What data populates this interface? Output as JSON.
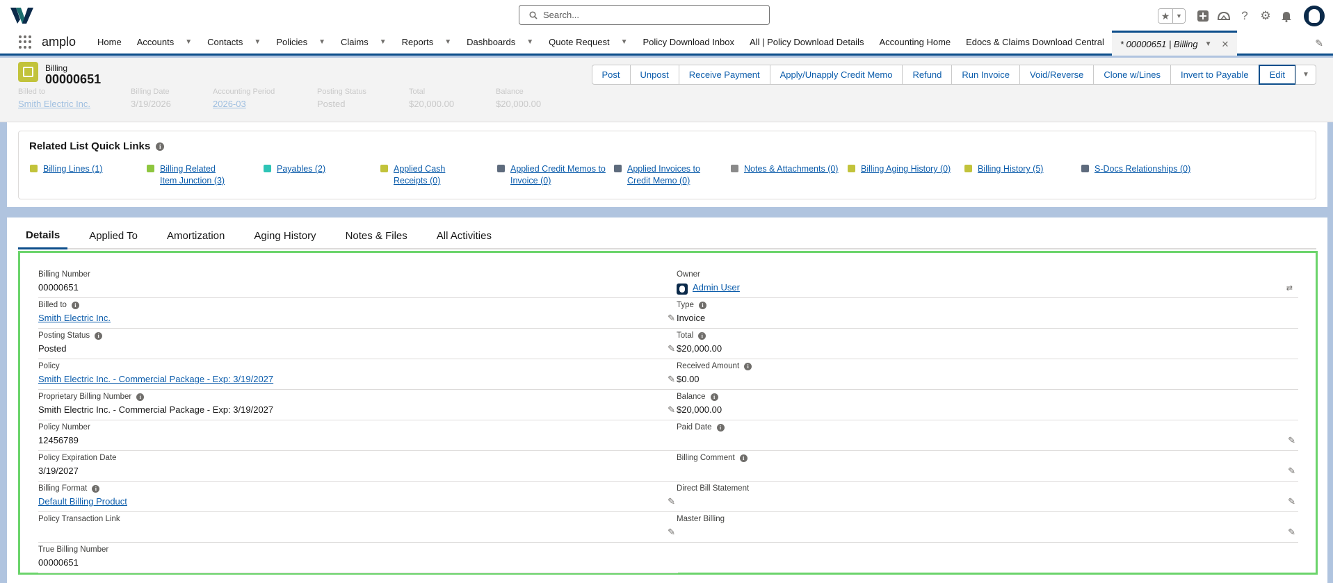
{
  "search": {
    "placeholder": "Search..."
  },
  "nav": {
    "app_name": "amplo",
    "items": [
      {
        "label": "Home",
        "has_menu": false
      },
      {
        "label": "Accounts",
        "has_menu": true
      },
      {
        "label": "Contacts",
        "has_menu": true
      },
      {
        "label": "Policies",
        "has_menu": true
      },
      {
        "label": "Claims",
        "has_menu": true
      },
      {
        "label": "Reports",
        "has_menu": true
      },
      {
        "label": "Dashboards",
        "has_menu": true
      },
      {
        "label": "Quote Request",
        "has_menu": true
      },
      {
        "label": "Policy Download Inbox",
        "has_menu": false
      },
      {
        "label": "All | Policy Download Details",
        "has_menu": false
      },
      {
        "label": "Accounting Home",
        "has_menu": false
      },
      {
        "label": "Edocs & Claims Download Central",
        "has_menu": false
      }
    ],
    "active_tab": "* 00000651 | Billing"
  },
  "record": {
    "object_label": "Billing",
    "name": "00000651",
    "actions": [
      "Post",
      "Unpost",
      "Receive Payment",
      "Apply/Unapply Credit Memo",
      "Refund",
      "Run Invoice",
      "Void/Reverse",
      "Clone w/Lines",
      "Invert to Payable",
      "Edit"
    ],
    "highlights": [
      {
        "label": "Billed to",
        "value": "Smith Electric Inc.",
        "link": true
      },
      {
        "label": "Billing Date",
        "value": "3/19/2026",
        "link": false
      },
      {
        "label": "Accounting Period",
        "value": "2026-03",
        "link": true
      },
      {
        "label": "Posting Status",
        "value": "Posted",
        "link": false
      },
      {
        "label": "Total",
        "value": "$20,000.00",
        "link": false
      },
      {
        "label": "Balance",
        "value": "$20,000.00",
        "link": false
      }
    ]
  },
  "quick_links": {
    "title": "Related List Quick Links",
    "items": [
      {
        "label": "Billing Lines (1)",
        "color": "#c2c33b"
      },
      {
        "label": "Billing Related Item Junction (3)",
        "color": "#8ec63f"
      },
      {
        "label": "Payables (2)",
        "color": "#2ec4b6"
      },
      {
        "label": "Applied Cash Receipts (0)",
        "color": "#c2c33b"
      },
      {
        "label": "Applied Credit Memos to Invoice (0)",
        "color": "#5e6b7d"
      },
      {
        "label": "Applied Invoices to Credit Memo (0)",
        "color": "#5e6b7d"
      },
      {
        "label": "Notes & Attachments (0)",
        "color": "#8a8a8a"
      },
      {
        "label": "Billing Aging History (0)",
        "color": "#c2c33b"
      },
      {
        "label": "Billing History (5)",
        "color": "#c2c33b"
      },
      {
        "label": "S-Docs Relationships (0)",
        "color": "#5e6b7d"
      }
    ]
  },
  "tabs": [
    "Details",
    "Applied To",
    "Amortization",
    "Aging History",
    "Notes & Files",
    "All Activities"
  ],
  "details": {
    "left": [
      {
        "label": "Billing Number",
        "value": "00000651",
        "link": false,
        "info": false,
        "editable": false
      },
      {
        "label": "Billed to",
        "value": "Smith Electric Inc.",
        "link": true,
        "info": true,
        "editable": true
      },
      {
        "label": "Posting Status",
        "value": "Posted",
        "link": false,
        "info": true,
        "editable": true
      },
      {
        "label": "Policy",
        "value": "Smith Electric Inc. - Commercial Package - Exp: 3/19/2027",
        "link": true,
        "info": false,
        "editable": true
      },
      {
        "label": "Proprietary Billing Number",
        "value": "Smith Electric Inc. - Commercial Package - Exp: 3/19/2027",
        "link": false,
        "info": true,
        "editable": true
      },
      {
        "label": "Policy Number",
        "value": "12456789",
        "link": false,
        "info": false,
        "editable": false
      },
      {
        "label": "Policy Expiration Date",
        "value": "3/19/2027",
        "link": false,
        "info": false,
        "editable": false
      },
      {
        "label": "Billing Format",
        "value": "Default Billing Product",
        "link": true,
        "info": true,
        "editable": true
      },
      {
        "label": "Policy Transaction Link",
        "value": "",
        "link": false,
        "info": false,
        "editable": true
      },
      {
        "label": "True Billing Number",
        "value": "00000651",
        "link": false,
        "info": false,
        "editable": false
      }
    ],
    "right": [
      {
        "label": "Owner",
        "value": "Admin User",
        "link": true,
        "info": false,
        "editable": false
      },
      {
        "label": "Type",
        "value": "Invoice",
        "link": false,
        "info": true,
        "editable": false
      },
      {
        "label": "Total",
        "value": "$20,000.00",
        "link": false,
        "info": true,
        "editable": false
      },
      {
        "label": "Received Amount",
        "value": "$0.00",
        "link": false,
        "info": true,
        "editable": false
      },
      {
        "label": "Balance",
        "value": "$20,000.00",
        "link": false,
        "info": true,
        "editable": false
      },
      {
        "label": "Paid Date",
        "value": "",
        "link": false,
        "info": true,
        "editable": true
      },
      {
        "label": "Billing Comment",
        "value": "",
        "link": false,
        "info": true,
        "editable": true
      },
      {
        "label": "Direct Bill Statement",
        "value": "",
        "link": false,
        "info": false,
        "editable": true
      },
      {
        "label": "Master Billing",
        "value": "",
        "link": false,
        "info": false,
        "editable": true
      }
    ]
  },
  "colors": {
    "brand": "#0d4e8b",
    "link": "#0b5cab",
    "focus_outline": "#6bd46b",
    "object_icon": "#c2c33b"
  }
}
